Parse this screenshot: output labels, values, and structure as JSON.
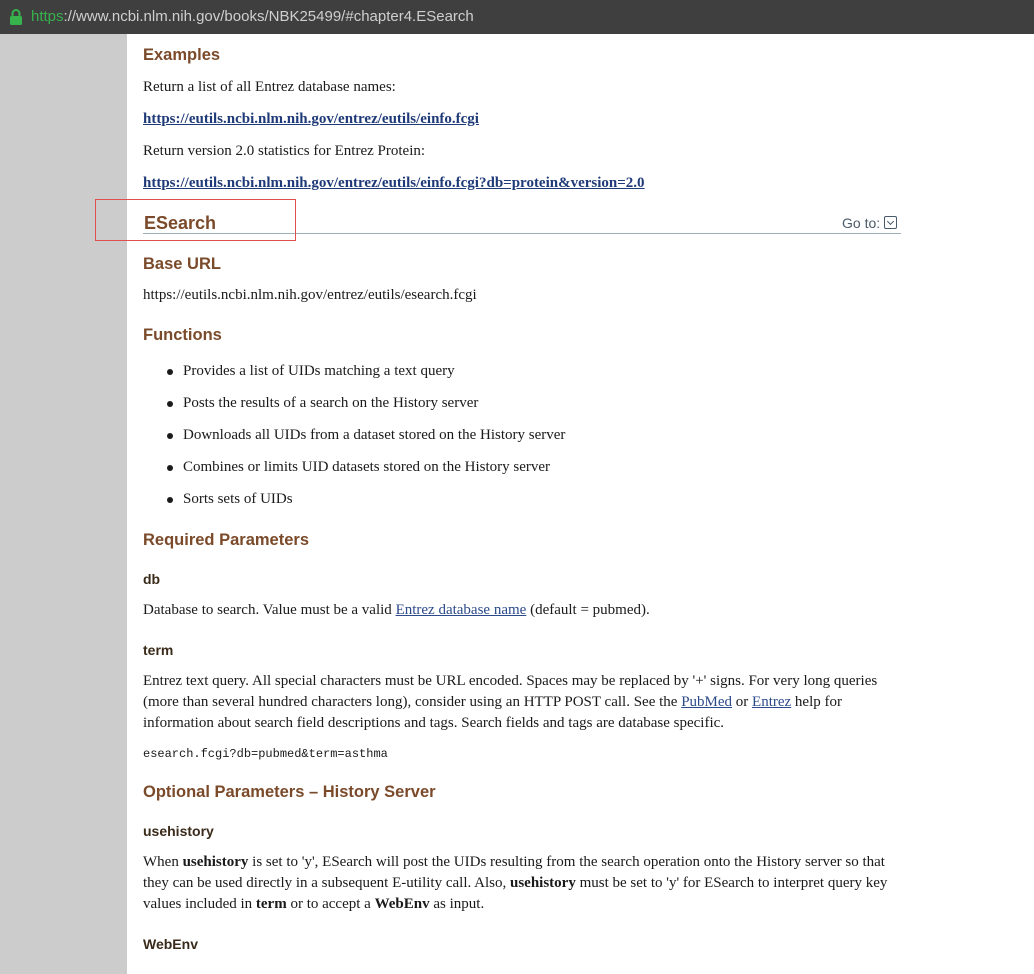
{
  "browser": {
    "url_scheme": "https",
    "url_rest": "://www.ncbi.nlm.nih.gov/books/NBK25499/#chapter4.ESearch"
  },
  "examples": {
    "heading": "Examples",
    "line1": "Return a list of all Entrez database names:",
    "link1": "https://eutils.ncbi.nlm.nih.gov/entrez/eutils/einfo.fcgi",
    "line2": "Return version 2.0 statistics for Entrez Protein:",
    "link2": "https://eutils.ncbi.nlm.nih.gov/entrez/eutils/einfo.fcgi?db=protein&version=2.0"
  },
  "esearch": {
    "heading": "ESearch",
    "goto_label": "Go to:"
  },
  "base_url": {
    "heading": "Base URL",
    "value": "https://eutils.ncbi.nlm.nih.gov/entrez/eutils/esearch.fcgi"
  },
  "functions": {
    "heading": "Functions",
    "items": [
      "Provides a list of UIDs matching a text query",
      "Posts the results of a search on the History server",
      "Downloads all UIDs from a dataset stored on the History server",
      "Combines or limits UID datasets stored on the History server",
      "Sorts sets of UIDs"
    ]
  },
  "required": {
    "heading": "Required Parameters",
    "db_label": "db",
    "db_text_before": "Database to search. Value must be a valid ",
    "db_link": "Entrez database name",
    "db_text_after": " (default = pubmed).",
    "term_label": "term",
    "term_text1": "Entrez text query. All special characters must be URL encoded. Spaces may be replaced by '+' signs. For very long queries (more than several hundred characters long), consider using an HTTP POST call. See the ",
    "term_link1": "PubMed",
    "term_text2": " or ",
    "term_link2": "Entrez",
    "term_text3": " help for information about search field descriptions and tags. Search fields and tags are database specific.",
    "term_example": "esearch.fcgi?db=pubmed&term=asthma"
  },
  "optional": {
    "heading": "Optional Parameters – History Server",
    "usehistory_label": "usehistory",
    "uh_t1": "When ",
    "uh_b1": "usehistory",
    "uh_t2": " is set to 'y', ESearch will post the UIDs resulting from the search operation onto the History server so that they can be used directly in a subsequent E-utility call. Also, ",
    "uh_b2": "usehistory",
    "uh_t3": " must be set to 'y' for ESearch to interpret query key values included in ",
    "uh_b3": "term",
    "uh_t4": " or to accept a ",
    "uh_b4": "WebEnv",
    "uh_t5": " as input.",
    "webenv_label": "WebEnv"
  }
}
